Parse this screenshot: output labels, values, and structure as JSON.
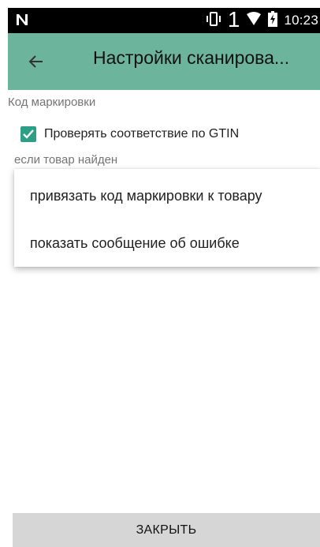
{
  "status_bar": {
    "sim_number": "1",
    "time": "10:23",
    "icons": [
      "n-logo-icon",
      "vibrate-icon",
      "wifi-icon",
      "battery-charging-icon"
    ]
  },
  "app_bar": {
    "title": "Настройки сканирова...",
    "back_icon": "arrow-left-icon",
    "color": "#6cb49b"
  },
  "content": {
    "section_title": "Код маркировки",
    "checkbox": {
      "label": "Проверять соответствие по GTIN",
      "checked": true,
      "color": "#2e9f86"
    },
    "sub_label": "если товар найден"
  },
  "dropdown": {
    "items": [
      "привязать код маркировки к товару",
      "показать сообщение об ошибке"
    ]
  },
  "footer": {
    "close_label": "ЗАКРЫТЬ"
  }
}
